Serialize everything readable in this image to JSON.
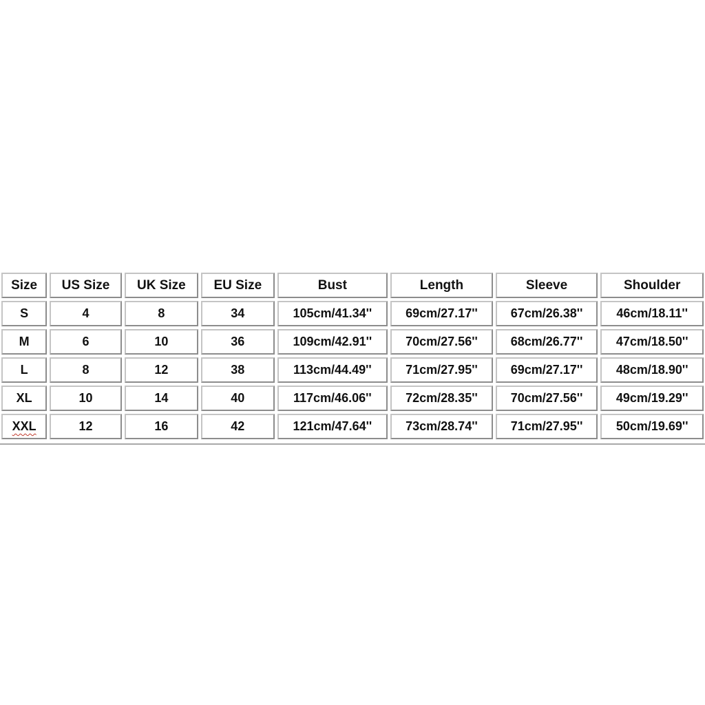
{
  "size_chart": {
    "headers": [
      "Size",
      "US Size",
      "UK Size",
      "EU Size",
      "Bust",
      "Length",
      "Sleeve",
      "Shoulder"
    ],
    "rows": [
      [
        "S",
        "4",
        "8",
        "34",
        "105cm/41.34''",
        "69cm/27.17''",
        "67cm/26.38''",
        "46cm/18.11''"
      ],
      [
        "M",
        "6",
        "10",
        "36",
        "109cm/42.91''",
        "70cm/27.56''",
        "68cm/26.77''",
        "47cm/18.50''"
      ],
      [
        "L",
        "8",
        "12",
        "38",
        "113cm/44.49''",
        "71cm/27.95''",
        "69cm/27.17''",
        "48cm/18.90''"
      ],
      [
        "XL",
        "10",
        "14",
        "40",
        "117cm/46.06''",
        "72cm/28.35''",
        "70cm/27.56''",
        "49cm/19.29''"
      ],
      [
        "XXL",
        "12",
        "16",
        "42",
        "121cm/47.64''",
        "73cm/28.74''",
        "71cm/27.95''",
        "50cm/19.69''"
      ]
    ],
    "spellcheck_flagged": [
      "XXL"
    ]
  },
  "chart_data": {
    "type": "table",
    "title": "",
    "columns": [
      "Size",
      "US Size",
      "UK Size",
      "EU Size",
      "Bust",
      "Length",
      "Sleeve",
      "Shoulder"
    ],
    "rows": [
      {
        "Size": "S",
        "US Size": 4,
        "UK Size": 8,
        "EU Size": 34,
        "Bust": "105cm/41.34''",
        "Length": "69cm/27.17''",
        "Sleeve": "67cm/26.38''",
        "Shoulder": "46cm/18.11''"
      },
      {
        "Size": "M",
        "US Size": 6,
        "UK Size": 10,
        "EU Size": 36,
        "Bust": "109cm/42.91''",
        "Length": "70cm/27.56''",
        "Sleeve": "68cm/26.77''",
        "Shoulder": "47cm/18.50''"
      },
      {
        "Size": "L",
        "US Size": 8,
        "UK Size": 12,
        "EU Size": 38,
        "Bust": "113cm/44.49''",
        "Length": "71cm/27.95''",
        "Sleeve": "69cm/27.17''",
        "Shoulder": "48cm/18.90''"
      },
      {
        "Size": "XL",
        "US Size": 10,
        "UK Size": 14,
        "EU Size": 40,
        "Bust": "117cm/46.06''",
        "Length": "72cm/28.35''",
        "Sleeve": "70cm/27.56''",
        "Shoulder": "49cm/19.29''"
      },
      {
        "Size": "XXL",
        "US Size": 12,
        "UK Size": 16,
        "EU Size": 42,
        "Bust": "121cm/47.64''",
        "Length": "73cm/28.74''",
        "Sleeve": "71cm/27.95''",
        "Shoulder": "50cm/19.69''"
      }
    ]
  }
}
